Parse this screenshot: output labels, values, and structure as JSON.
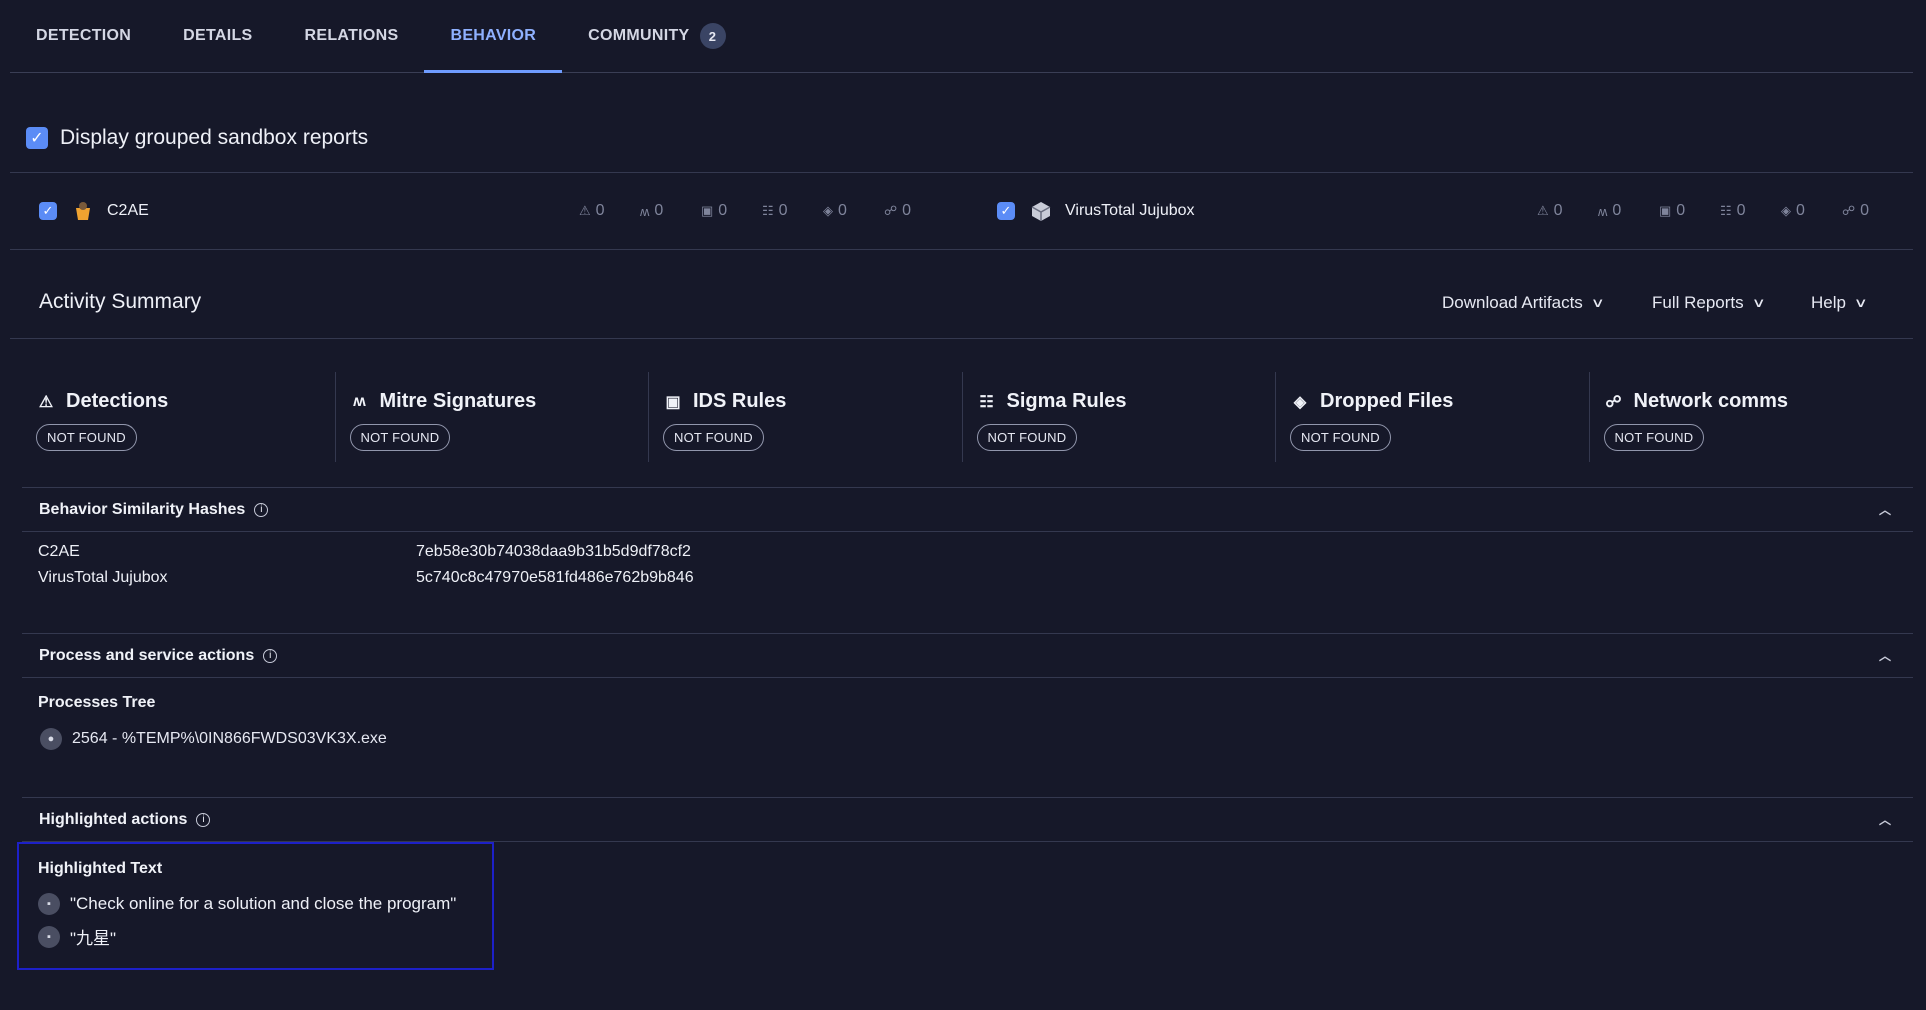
{
  "tabs": [
    {
      "label": "DETECTION"
    },
    {
      "label": "DETAILS"
    },
    {
      "label": "RELATIONS"
    },
    {
      "label": "BEHAVIOR"
    },
    {
      "label": "COMMUNITY",
      "badge": "2"
    }
  ],
  "active_tab": "BEHAVIOR",
  "group_toggle": {
    "label": "Display grouped sandbox reports",
    "checked": true
  },
  "sandboxes": [
    {
      "name": "C2AE",
      "checked": true,
      "stats": [
        "0",
        "0",
        "0",
        "0",
        "0",
        "0"
      ]
    },
    {
      "name": "VirusTotal Jujubox",
      "checked": true,
      "stats": [
        "0",
        "0",
        "0",
        "0",
        "0",
        "0"
      ]
    }
  ],
  "activity": {
    "title": "Activity Summary",
    "buttons": {
      "download": "Download Artifacts",
      "full_reports": "Full Reports",
      "help": "Help"
    },
    "cards": [
      {
        "title": "Detections",
        "status": "NOT FOUND",
        "icon": "warning-icon"
      },
      {
        "title": "Mitre Signatures",
        "status": "NOT FOUND",
        "icon": "mitre-icon"
      },
      {
        "title": "IDS Rules",
        "status": "NOT FOUND",
        "icon": "ids-icon"
      },
      {
        "title": "Sigma Rules",
        "status": "NOT FOUND",
        "icon": "sigma-icon"
      },
      {
        "title": "Dropped Files",
        "status": "NOT FOUND",
        "icon": "dropped-files-icon"
      },
      {
        "title": "Network comms",
        "status": "NOT FOUND",
        "icon": "network-icon"
      }
    ]
  },
  "similarity": {
    "title": "Behavior Similarity Hashes",
    "rows": [
      {
        "sandbox": "C2AE",
        "hash": "7eb58e30b74038daa9b31b5d9df78cf2"
      },
      {
        "sandbox": "VirusTotal Jujubox",
        "hash": "5c740c8c47970e581fd486e762b9b846"
      }
    ]
  },
  "process": {
    "title": "Process and service actions",
    "tree_title": "Processes Tree",
    "items": [
      "2564 - %TEMP%\\0IN866FWDS03VK3X.exe"
    ]
  },
  "highlighted": {
    "title": "Highlighted actions",
    "text_title": "Highlighted Text",
    "items": [
      "\"Check online for a solution and close the program\"",
      "\"九星\""
    ]
  }
}
